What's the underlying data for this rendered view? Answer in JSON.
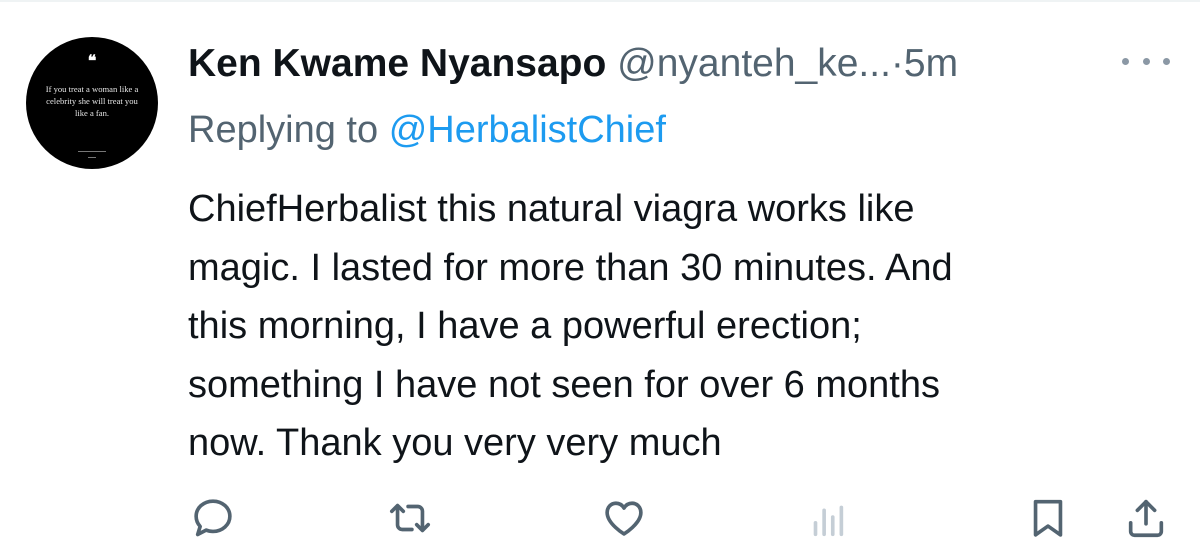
{
  "tweet": {
    "author_name": "Ken Kwame Nyansapo",
    "author_handle": "@nyanteh_ke...",
    "separator": "·",
    "timestamp": "5m",
    "replying_prefix": "Replying to",
    "replying_to": "@HerbalistChief",
    "text": "ChiefHerbalist this natural viagra works like\nmagic. I lasted for more than 30 minutes. And\nthis morning, I have a powerful erection;\nsomething I have not seen for over 6 months\nnow. Thank you very very much"
  },
  "avatar": {
    "quote_mark": "❝",
    "quote_text": "If you treat a woman like a celebrity she will treat you like a fan."
  },
  "actions": {
    "reply_icon": "reply-icon",
    "repost_icon": "repost-icon",
    "like_icon": "heart-icon",
    "views_icon": "views-icon",
    "bookmark_icon": "bookmark-icon",
    "share_icon": "share-icon"
  },
  "colors": {
    "text_primary": "#0f1419",
    "text_secondary": "#536471",
    "link": "#1d9bf0",
    "icon": "#536471",
    "views_icon_faded": "#c5ced6"
  }
}
